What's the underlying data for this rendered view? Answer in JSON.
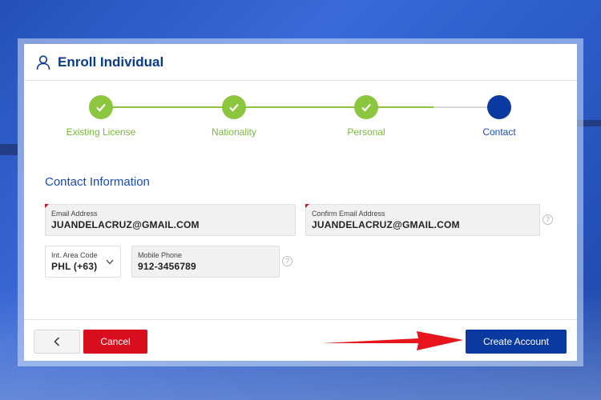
{
  "header": {
    "title": "Enroll Individual",
    "icon": "user-icon"
  },
  "colors": {
    "primary": "#0a3aa0",
    "success": "#8cc63f",
    "danger": "#d80d1d",
    "annotation": "#e8141c"
  },
  "stepper": {
    "steps": [
      {
        "label": "Existing License",
        "status": "done"
      },
      {
        "label": "Nationality",
        "status": "done"
      },
      {
        "label": "Personal",
        "status": "done"
      },
      {
        "label": "Contact",
        "status": "active"
      }
    ]
  },
  "form": {
    "section_title": "Contact Information",
    "email": {
      "label": "Email Address",
      "value": "JUANDELACRUZ@GMAIL.COM"
    },
    "confirm_email": {
      "label": "Confirm Email Address",
      "value": "JUANDELACRUZ@GMAIL.COM"
    },
    "area_code": {
      "label": "Int. Area Code",
      "value": "PHL (+63)"
    },
    "mobile": {
      "label": "Mobile Phone",
      "value": "912-3456789"
    },
    "help_glyph": "?"
  },
  "footer": {
    "cancel_label": "Cancel",
    "create_label": "Create Account"
  }
}
